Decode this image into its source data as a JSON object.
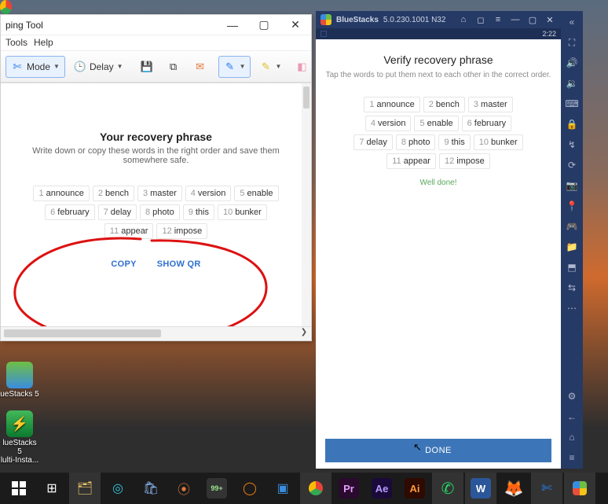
{
  "snip": {
    "title": "ping Tool",
    "menu": {
      "tools": "Tools",
      "help": "Help"
    },
    "toolbar": {
      "mode": "Mode",
      "delay": "Delay"
    },
    "doc": {
      "heading": "Your recovery phrase",
      "desc": "Write down or copy these words in the right order and save them somewhere safe."
    },
    "actions": {
      "copy": "COPY",
      "showqr": "SHOW QR"
    }
  },
  "words": [
    {
      "n": "1",
      "w": "announce"
    },
    {
      "n": "2",
      "w": "bench"
    },
    {
      "n": "3",
      "w": "master"
    },
    {
      "n": "4",
      "w": "version"
    },
    {
      "n": "5",
      "w": "enable"
    },
    {
      "n": "6",
      "w": "february"
    },
    {
      "n": "7",
      "w": "delay"
    },
    {
      "n": "8",
      "w": "photo"
    },
    {
      "n": "9",
      "w": "this"
    },
    {
      "n": "10",
      "w": "bunker"
    },
    {
      "n": "11",
      "w": "appear"
    },
    {
      "n": "12",
      "w": "impose"
    }
  ],
  "bs": {
    "title": "BlueStacks",
    "version": "5.0.230.1001 N32",
    "clock": "2:22",
    "heading": "Verify recovery phrase",
    "sub": "Tap the words to put them next to each other in the correct order.",
    "welldone": "Well done!",
    "done": "DONE"
  },
  "desktop_icons": {
    "bs5": "ueStacks 5",
    "bs5multi1": "lueStacks 5",
    "bs5multi2": "lulti-Insta..."
  },
  "taskbar_badge": "99+"
}
